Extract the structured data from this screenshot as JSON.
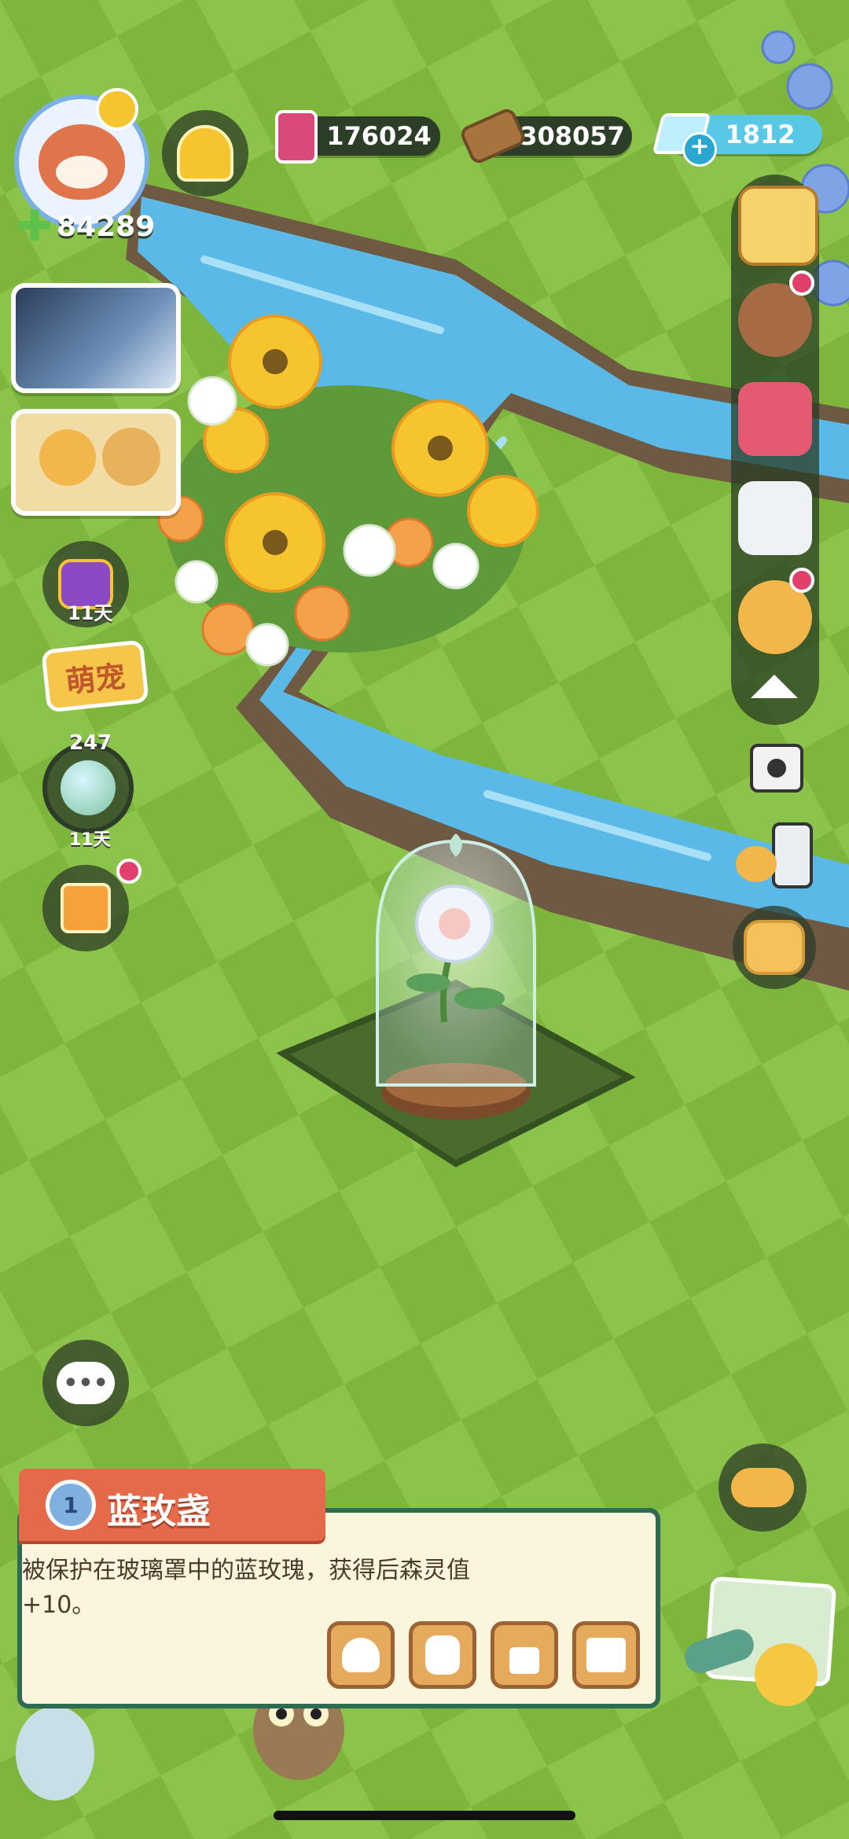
{
  "resources": {
    "jam": "176024",
    "wood": "308057",
    "gems": "1812"
  },
  "player": {
    "clover_count": "84289"
  },
  "left_column": {
    "event_timer_1": "11天",
    "pet_badge": "萌宠",
    "orb_count": "247",
    "orb_timer": "11天"
  },
  "item_card": {
    "level": "1",
    "name": "蓝玫盏",
    "description_line1": "被保护在玻璃罩中的蓝玫瑰，获得后森灵值",
    "description_line2": "+10。"
  },
  "icons": {
    "announcement": "bell-icon",
    "chat": "chat-bubble-icon",
    "camera": "camera-icon",
    "collapse": "triangle-up-icon"
  },
  "colors": {
    "grass_light": "#8cc34a",
    "grass_dark": "#78ad3a",
    "river": "#5bb9e8",
    "card_bg": "#fbf5dd",
    "card_border": "#2f6a55",
    "banner": "#e46a4a"
  }
}
